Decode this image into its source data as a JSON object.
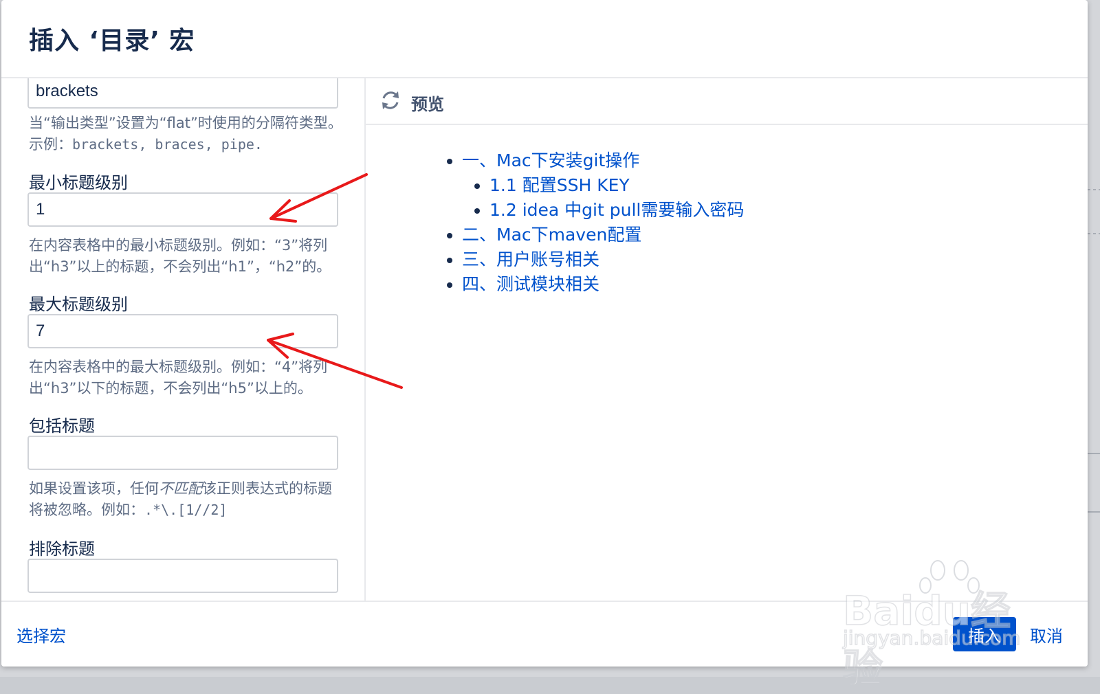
{
  "dialog": {
    "title": "插入 ‘目录’ 宏"
  },
  "form": {
    "separator": {
      "value": "brackets",
      "help_prefix": "当“输出类型”设置为“flat”时使用的分隔符类型。示例：",
      "help_code": "brackets, braces, pipe."
    },
    "min_level": {
      "label": "最小标题级别",
      "value": "1",
      "help": "在内容表格中的最小标题级别。例如：“3”将列出“h3”以上的标题，不会列出“h1”，“h2”的。"
    },
    "max_level": {
      "label": "最大标题级别",
      "value": "7",
      "help": "在内容表格中的最大标题级别。例如：“4”将列出“h3”以下的标题，不会列出“h5”以上的。"
    },
    "include": {
      "label": "包括标题",
      "value": "",
      "help_prefix": "如果设置该项，任何",
      "help_em": "不匹配",
      "help_middle": "该正则表达式的标题将被忽略。例如：",
      "help_code": ".*\\.[1//2]"
    },
    "exclude": {
      "label": "排除标题",
      "value": ""
    }
  },
  "preview": {
    "title": "预览",
    "icon": "refresh-icon",
    "toc": [
      {
        "label": "一、Mac下安装git操作",
        "children": [
          "1.1 配置SSH KEY",
          "1.2 idea 中git pull需要输入密码"
        ]
      },
      {
        "label": "二、Mac下maven配置"
      },
      {
        "label": "三、用户账号相关"
      },
      {
        "label": "四、测试模块相关"
      }
    ]
  },
  "footer": {
    "select_macro": "选择宏",
    "insert": "插入",
    "cancel": "取消"
  },
  "watermark": {
    "brand": "Baidu经验",
    "url": "jingyan.baidu.com"
  },
  "colors": {
    "primary": "#0052cc",
    "text": "#172b4d",
    "help": "#5e6c84",
    "annotation_arrow": "#e8191a"
  }
}
